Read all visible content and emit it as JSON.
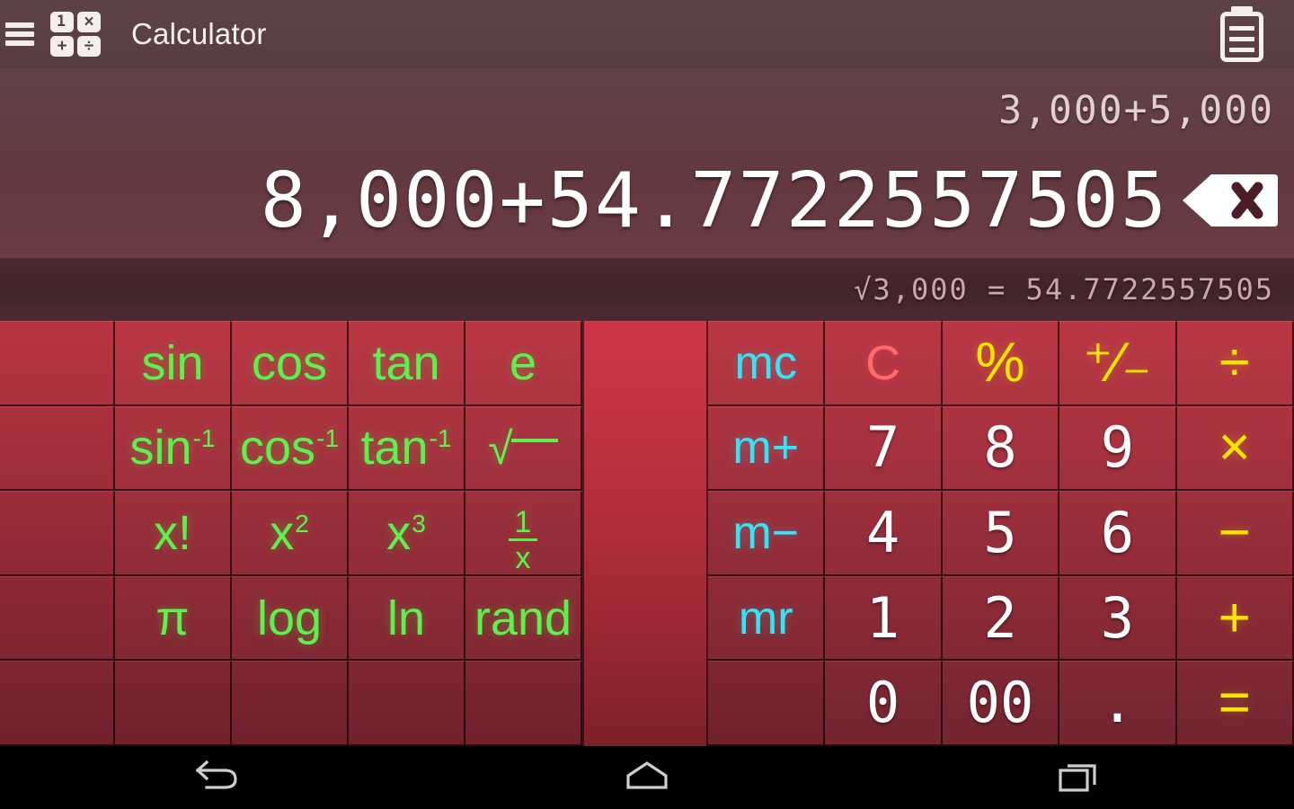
{
  "app": {
    "title": "Calculator",
    "menu_icon": "hamburger-menu-icon",
    "logo_icon": "calculator-app-icon",
    "logo_cells": [
      "1",
      "×",
      "+",
      "÷"
    ],
    "history_icon": "clipboard-history-icon"
  },
  "display": {
    "previous_expression": "3,000+5,000",
    "current_expression": "8,000+54.7722557505",
    "backspace_icon": "backspace-delete-icon",
    "history_entry": "√3,000 = 54.7722557505"
  },
  "colors": {
    "function_green": "#5ef04e",
    "memory_cyan": "#33e5f7",
    "clear_red": "#ff6a6a",
    "operator_yellow": "#ffe600",
    "digit_white": "#ffffff",
    "keypad_red": "#a32b39",
    "display_mauve": "#5f4348",
    "history_band": "#3f242a",
    "appbar": "#5a4045"
  },
  "scientific_keypad": {
    "columns": 5,
    "rows": [
      [
        {
          "label": "",
          "kind": "blank",
          "name": "sci-key-blank-r1"
        },
        {
          "label": "sin",
          "kind": "fn",
          "name": "sci-key-sin"
        },
        {
          "label": "cos",
          "kind": "fn",
          "name": "sci-key-cos"
        },
        {
          "label": "tan",
          "kind": "fn",
          "name": "sci-key-tan"
        },
        {
          "label": "e",
          "kind": "fn",
          "name": "sci-key-e"
        }
      ],
      [
        {
          "label": "",
          "kind": "blank",
          "name": "sci-key-blank-r2"
        },
        {
          "label": "sin",
          "sup": "-1",
          "kind": "fn",
          "name": "sci-key-asin"
        },
        {
          "label": "cos",
          "sup": "-1",
          "kind": "fn",
          "name": "sci-key-acos"
        },
        {
          "label": "tan",
          "sup": "-1",
          "kind": "fn",
          "name": "sci-key-atan"
        },
        {
          "label": "√",
          "kind": "sqrt",
          "name": "sci-key-sqrt"
        }
      ],
      [
        {
          "label": "",
          "kind": "blank",
          "name": "sci-key-blank-r3"
        },
        {
          "label": "x!",
          "kind": "fn",
          "name": "sci-key-factorial"
        },
        {
          "label": "x",
          "sup": "2",
          "kind": "fn",
          "name": "sci-key-square"
        },
        {
          "label": "x",
          "sup": "3",
          "kind": "fn",
          "name": "sci-key-cube"
        },
        {
          "label": "1/x",
          "kind": "frac",
          "num": "1",
          "den": "x",
          "name": "sci-key-reciprocal"
        }
      ],
      [
        {
          "label": "",
          "kind": "blank",
          "name": "sci-key-blank-r4"
        },
        {
          "label": "π",
          "kind": "fn",
          "name": "sci-key-pi"
        },
        {
          "label": "log",
          "kind": "fn",
          "name": "sci-key-log"
        },
        {
          "label": "ln",
          "kind": "fn",
          "name": "sci-key-ln"
        },
        {
          "label": "rand",
          "kind": "fn",
          "name": "sci-key-rand"
        }
      ],
      [
        {
          "label": "",
          "kind": "blank",
          "name": "sci-key-blank-r5c1"
        },
        {
          "label": "",
          "kind": "blank",
          "name": "sci-key-blank-r5c2"
        },
        {
          "label": "",
          "kind": "blank",
          "name": "sci-key-blank-r5c3"
        },
        {
          "label": "",
          "kind": "blank",
          "name": "sci-key-blank-r5c4"
        },
        {
          "label": "",
          "kind": "blank",
          "name": "sci-key-blank-r5c5"
        }
      ]
    ]
  },
  "main_keypad": {
    "columns": 5,
    "rows": [
      [
        {
          "label": "mc",
          "kind": "mem",
          "name": "key-memory-clear"
        },
        {
          "label": "C",
          "kind": "clr",
          "name": "key-clear"
        },
        {
          "label": "%",
          "kind": "op",
          "name": "key-percent"
        },
        {
          "label": "⁺∕₋",
          "kind": "op",
          "name": "key-plus-minus"
        },
        {
          "label": "÷",
          "kind": "op",
          "name": "key-divide"
        }
      ],
      [
        {
          "label": "m+",
          "kind": "mem",
          "name": "key-memory-add"
        },
        {
          "label": "7",
          "kind": "num",
          "name": "key-7"
        },
        {
          "label": "8",
          "kind": "num",
          "name": "key-8"
        },
        {
          "label": "9",
          "kind": "num",
          "name": "key-9"
        },
        {
          "label": "×",
          "kind": "op",
          "name": "key-multiply"
        }
      ],
      [
        {
          "label": "m−",
          "kind": "mem",
          "name": "key-memory-subtract"
        },
        {
          "label": "4",
          "kind": "num",
          "name": "key-4"
        },
        {
          "label": "5",
          "kind": "num",
          "name": "key-5"
        },
        {
          "label": "6",
          "kind": "num",
          "name": "key-6"
        },
        {
          "label": "−",
          "kind": "op",
          "name": "key-subtract"
        }
      ],
      [
        {
          "label": "mr",
          "kind": "mem",
          "name": "key-memory-recall"
        },
        {
          "label": "1",
          "kind": "num",
          "name": "key-1"
        },
        {
          "label": "2",
          "kind": "num",
          "name": "key-2"
        },
        {
          "label": "3",
          "kind": "num",
          "name": "key-3"
        },
        {
          "label": "+",
          "kind": "op",
          "name": "key-add"
        }
      ],
      [
        {
          "label": "",
          "kind": "blank",
          "name": "key-blank-bottom"
        },
        {
          "label": "0",
          "kind": "num",
          "name": "key-0"
        },
        {
          "label": "00",
          "kind": "num",
          "name": "key-double-zero"
        },
        {
          "label": ".",
          "kind": "num",
          "name": "key-decimal-point"
        },
        {
          "label": "=",
          "kind": "op",
          "name": "key-equals"
        }
      ]
    ]
  },
  "divider": {
    "name": "keypad-drag-divider"
  },
  "navbar": {
    "back": "back-nav-icon",
    "home": "home-nav-icon",
    "recents": "recent-apps-nav-icon"
  }
}
